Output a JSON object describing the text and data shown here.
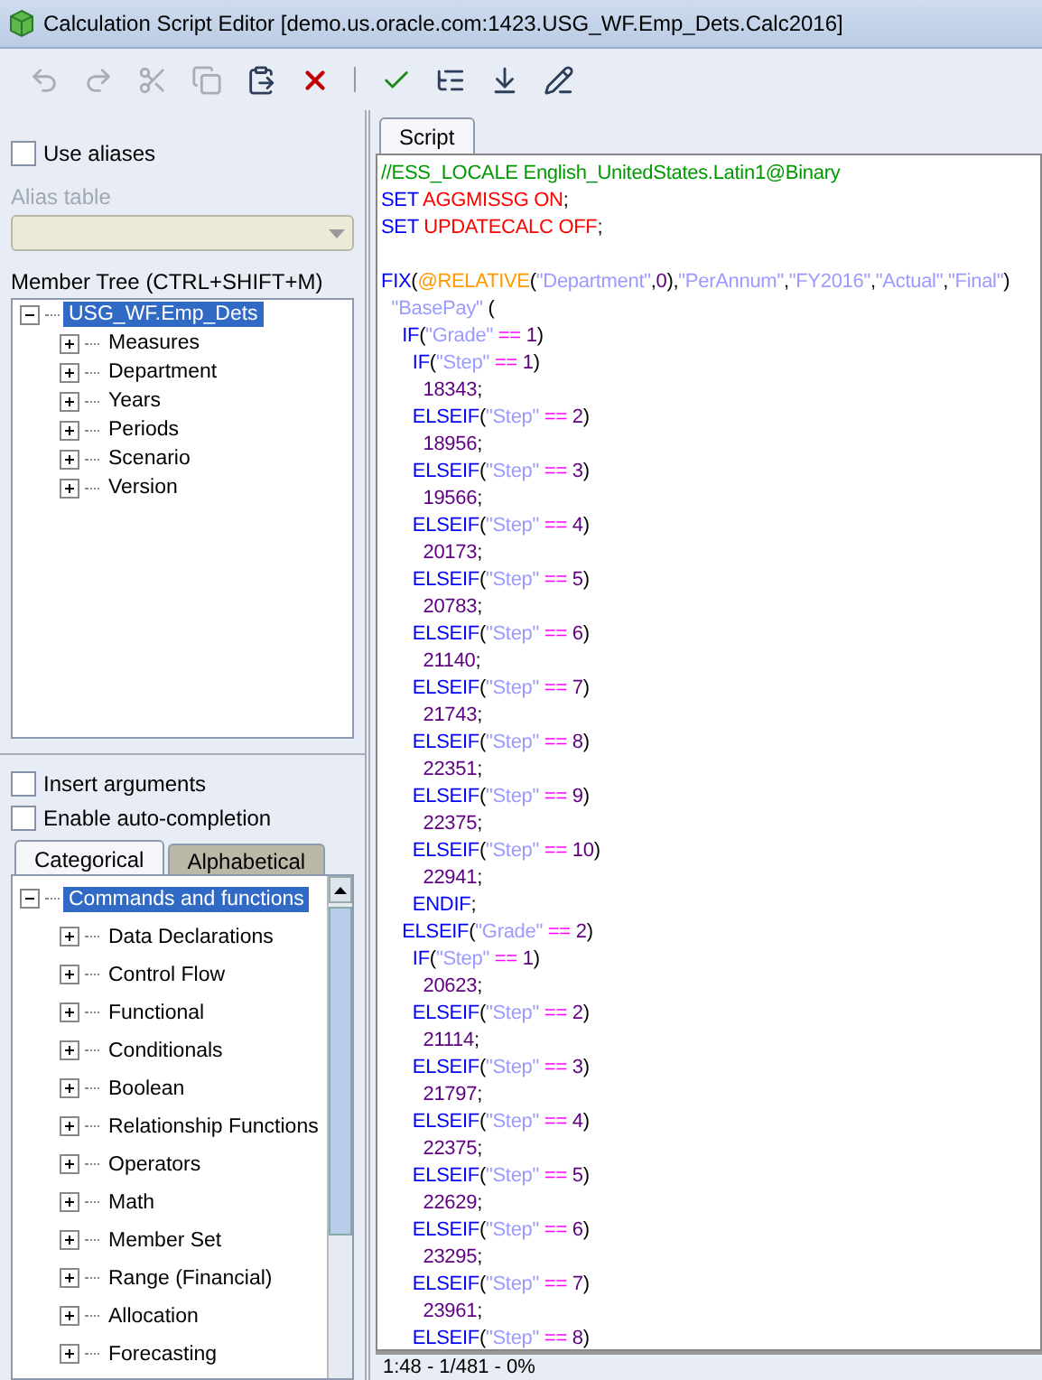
{
  "window": {
    "title": "Calculation Script Editor [demo.us.oracle.com:1423.USG_WF.Emp_Dets.Calc2016]"
  },
  "toolbar": [
    {
      "kind": "undo",
      "disabled": true
    },
    {
      "kind": "redo",
      "disabled": true
    },
    {
      "kind": "cut",
      "disabled": true
    },
    {
      "kind": "copy",
      "disabled": true
    },
    {
      "kind": "paste",
      "disabled": false
    },
    {
      "kind": "delete",
      "disabled": false
    },
    {
      "kind": "separator"
    },
    {
      "kind": "validate",
      "disabled": false
    },
    {
      "kind": "outline",
      "disabled": false
    },
    {
      "kind": "download",
      "disabled": false
    },
    {
      "kind": "insert",
      "disabled": false
    }
  ],
  "left_panel": {
    "use_aliases": {
      "label": "Use aliases",
      "checked": false
    },
    "alias_table": {
      "label": "Alias table",
      "disabled": true
    },
    "member_tree": {
      "label": "Member Tree (CTRL+SHIFT+M)",
      "items": [
        {
          "label": "USG_WF.Emp_Dets",
          "selected": true,
          "expanded": true,
          "children": [
            {
              "label": "Measures",
              "selected": false,
              "expanded": false
            },
            {
              "label": "Department",
              "selected": false,
              "expanded": false
            },
            {
              "label": "Years",
              "selected": false,
              "expanded": false
            },
            {
              "label": "Periods",
              "selected": false,
              "expanded": false
            },
            {
              "label": "Scenario",
              "selected": false,
              "expanded": false
            },
            {
              "label": "Version",
              "selected": false,
              "expanded": false
            }
          ]
        }
      ]
    },
    "options": [
      {
        "label": "Insert arguments",
        "checked": false
      },
      {
        "label": "Enable auto-completion",
        "checked": false
      }
    ],
    "tabs": [
      {
        "label": "Categorical",
        "selected": true
      },
      {
        "label": "Alphabetical",
        "selected": false
      }
    ],
    "function_tree": {
      "items": [
        {
          "label": "Commands and functions",
          "selected": true,
          "expanded": true,
          "children": [
            {
              "label": "Data Declarations",
              "selected": false,
              "expanded": false
            },
            {
              "label": "Control Flow",
              "selected": false,
              "expanded": false
            },
            {
              "label": "Functional",
              "selected": false,
              "expanded": false
            },
            {
              "label": "Conditionals",
              "selected": false,
              "expanded": false
            },
            {
              "label": "Boolean",
              "selected": false,
              "expanded": false
            },
            {
              "label": "Relationship Functions",
              "selected": false,
              "expanded": false
            },
            {
              "label": "Operators",
              "selected": false,
              "expanded": false
            },
            {
              "label": "Math",
              "selected": false,
              "expanded": false
            },
            {
              "label": "Member Set",
              "selected": false,
              "expanded": false
            },
            {
              "label": "Range (Financial)",
              "selected": false,
              "expanded": false
            },
            {
              "label": "Allocation",
              "selected": false,
              "expanded": false
            },
            {
              "label": "Forecasting",
              "selected": false,
              "expanded": false
            }
          ]
        }
      ]
    }
  },
  "editor": {
    "tabs": [
      {
        "label": "Script",
        "selected": true
      }
    ],
    "lines": [
      {
        "kind": "code",
        "tokens": [
          {
            "kind": "comment",
            "text": "//ESS_LOCALE English_UnitedStates.Latin1@Binary"
          }
        ]
      },
      {
        "kind": "code",
        "tokens": [
          {
            "kind": "keyword",
            "text": "SET "
          },
          {
            "kind": "option",
            "text": "AGGMISSG ON"
          },
          {
            "kind": "punct",
            "text": ";"
          }
        ]
      },
      {
        "kind": "code",
        "tokens": [
          {
            "kind": "keyword",
            "text": "SET "
          },
          {
            "kind": "option",
            "text": "UPDATECALC OFF"
          },
          {
            "kind": "punct",
            "text": ";"
          }
        ]
      },
      {
        "kind": "blank"
      },
      {
        "kind": "code",
        "tokens": [
          {
            "kind": "keyword",
            "text": "FIX"
          },
          {
            "kind": "punct",
            "text": "("
          },
          {
            "kind": "function",
            "text": "@RELATIVE"
          },
          {
            "kind": "punct",
            "text": "("
          },
          {
            "kind": "string",
            "text": "\"Department\""
          },
          {
            "kind": "punct",
            "text": ","
          },
          {
            "kind": "number",
            "text": "0"
          },
          {
            "kind": "punct",
            "text": "),"
          },
          {
            "kind": "string",
            "text": "\"PerAnnum\""
          },
          {
            "kind": "punct",
            "text": ","
          },
          {
            "kind": "string",
            "text": "\"FY2016\""
          },
          {
            "kind": "punct",
            "text": ","
          },
          {
            "kind": "string",
            "text": "\"Actual\""
          },
          {
            "kind": "punct",
            "text": ","
          },
          {
            "kind": "string",
            "text": "\"Final\""
          },
          {
            "kind": "punct",
            "text": ")"
          }
        ]
      },
      {
        "kind": "code",
        "tokens": [
          {
            "kind": "string",
            "text": "  \"BasePay\""
          },
          {
            "kind": "punct",
            "text": " ("
          }
        ]
      },
      {
        "kind": "code",
        "tokens": [
          {
            "kind": "keyword",
            "text": "    IF"
          },
          {
            "kind": "punct",
            "text": "("
          },
          {
            "kind": "string",
            "text": "\"Grade\""
          },
          {
            "kind": "op",
            "text": " == "
          },
          {
            "kind": "number",
            "text": "1"
          },
          {
            "kind": "punct",
            "text": ")"
          }
        ]
      },
      {
        "kind": "code",
        "tokens": [
          {
            "kind": "keyword",
            "text": "      IF"
          },
          {
            "kind": "punct",
            "text": "("
          },
          {
            "kind": "string",
            "text": "\"Step\""
          },
          {
            "kind": "op",
            "text": " == "
          },
          {
            "kind": "number",
            "text": "1"
          },
          {
            "kind": "punct",
            "text": ")"
          }
        ]
      },
      {
        "kind": "code",
        "tokens": [
          {
            "kind": "number",
            "text": "        18343"
          },
          {
            "kind": "punct",
            "text": ";"
          }
        ]
      },
      {
        "kind": "code",
        "tokens": [
          {
            "kind": "keyword",
            "text": "      ELSEIF"
          },
          {
            "kind": "punct",
            "text": "("
          },
          {
            "kind": "string",
            "text": "\"Step\""
          },
          {
            "kind": "op",
            "text": " == "
          },
          {
            "kind": "number",
            "text": "2"
          },
          {
            "kind": "punct",
            "text": ")"
          }
        ]
      },
      {
        "kind": "code",
        "tokens": [
          {
            "kind": "number",
            "text": "        18956"
          },
          {
            "kind": "punct",
            "text": ";"
          }
        ]
      },
      {
        "kind": "code",
        "tokens": [
          {
            "kind": "keyword",
            "text": "      ELSEIF"
          },
          {
            "kind": "punct",
            "text": "("
          },
          {
            "kind": "string",
            "text": "\"Step\""
          },
          {
            "kind": "op",
            "text": " == "
          },
          {
            "kind": "number",
            "text": "3"
          },
          {
            "kind": "punct",
            "text": ")"
          }
        ]
      },
      {
        "kind": "code",
        "tokens": [
          {
            "kind": "number",
            "text": "        19566"
          },
          {
            "kind": "punct",
            "text": ";"
          }
        ]
      },
      {
        "kind": "code",
        "tokens": [
          {
            "kind": "keyword",
            "text": "      ELSEIF"
          },
          {
            "kind": "punct",
            "text": "("
          },
          {
            "kind": "string",
            "text": "\"Step\""
          },
          {
            "kind": "op",
            "text": " == "
          },
          {
            "kind": "number",
            "text": "4"
          },
          {
            "kind": "punct",
            "text": ")"
          }
        ]
      },
      {
        "kind": "code",
        "tokens": [
          {
            "kind": "number",
            "text": "        20173"
          },
          {
            "kind": "punct",
            "text": ";"
          }
        ]
      },
      {
        "kind": "code",
        "tokens": [
          {
            "kind": "keyword",
            "text": "      ELSEIF"
          },
          {
            "kind": "punct",
            "text": "("
          },
          {
            "kind": "string",
            "text": "\"Step\""
          },
          {
            "kind": "op",
            "text": " == "
          },
          {
            "kind": "number",
            "text": "5"
          },
          {
            "kind": "punct",
            "text": ")"
          }
        ]
      },
      {
        "kind": "code",
        "tokens": [
          {
            "kind": "number",
            "text": "        20783"
          },
          {
            "kind": "punct",
            "text": ";"
          }
        ]
      },
      {
        "kind": "code",
        "tokens": [
          {
            "kind": "keyword",
            "text": "      ELSEIF"
          },
          {
            "kind": "punct",
            "text": "("
          },
          {
            "kind": "string",
            "text": "\"Step\""
          },
          {
            "kind": "op",
            "text": " == "
          },
          {
            "kind": "number",
            "text": "6"
          },
          {
            "kind": "punct",
            "text": ")"
          }
        ]
      },
      {
        "kind": "code",
        "tokens": [
          {
            "kind": "number",
            "text": "        21140"
          },
          {
            "kind": "punct",
            "text": ";"
          }
        ]
      },
      {
        "kind": "code",
        "tokens": [
          {
            "kind": "keyword",
            "text": "      ELSEIF"
          },
          {
            "kind": "punct",
            "text": "("
          },
          {
            "kind": "string",
            "text": "\"Step\""
          },
          {
            "kind": "op",
            "text": " == "
          },
          {
            "kind": "number",
            "text": "7"
          },
          {
            "kind": "punct",
            "text": ")"
          }
        ]
      },
      {
        "kind": "code",
        "tokens": [
          {
            "kind": "number",
            "text": "        21743"
          },
          {
            "kind": "punct",
            "text": ";"
          }
        ]
      },
      {
        "kind": "code",
        "tokens": [
          {
            "kind": "keyword",
            "text": "      ELSEIF"
          },
          {
            "kind": "punct",
            "text": "("
          },
          {
            "kind": "string",
            "text": "\"Step\""
          },
          {
            "kind": "op",
            "text": " == "
          },
          {
            "kind": "number",
            "text": "8"
          },
          {
            "kind": "punct",
            "text": ")"
          }
        ]
      },
      {
        "kind": "code",
        "tokens": [
          {
            "kind": "number",
            "text": "        22351"
          },
          {
            "kind": "punct",
            "text": ";"
          }
        ]
      },
      {
        "kind": "code",
        "tokens": [
          {
            "kind": "keyword",
            "text": "      ELSEIF"
          },
          {
            "kind": "punct",
            "text": "("
          },
          {
            "kind": "string",
            "text": "\"Step\""
          },
          {
            "kind": "op",
            "text": " == "
          },
          {
            "kind": "number",
            "text": "9"
          },
          {
            "kind": "punct",
            "text": ")"
          }
        ]
      },
      {
        "kind": "code",
        "tokens": [
          {
            "kind": "number",
            "text": "        22375"
          },
          {
            "kind": "punct",
            "text": ";"
          }
        ]
      },
      {
        "kind": "code",
        "tokens": [
          {
            "kind": "keyword",
            "text": "      ELSEIF"
          },
          {
            "kind": "punct",
            "text": "("
          },
          {
            "kind": "string",
            "text": "\"Step\""
          },
          {
            "kind": "op",
            "text": " == "
          },
          {
            "kind": "number",
            "text": "10"
          },
          {
            "kind": "punct",
            "text": ")"
          }
        ]
      },
      {
        "kind": "code",
        "tokens": [
          {
            "kind": "number",
            "text": "        22941"
          },
          {
            "kind": "punct",
            "text": ";"
          }
        ]
      },
      {
        "kind": "code",
        "tokens": [
          {
            "kind": "keyword",
            "text": "      ENDIF"
          },
          {
            "kind": "punct",
            "text": ";"
          }
        ]
      },
      {
        "kind": "code",
        "tokens": [
          {
            "kind": "keyword",
            "text": "    ELSEIF"
          },
          {
            "kind": "punct",
            "text": "("
          },
          {
            "kind": "string",
            "text": "\"Grade\""
          },
          {
            "kind": "op",
            "text": " == "
          },
          {
            "kind": "number",
            "text": "2"
          },
          {
            "kind": "punct",
            "text": ")"
          }
        ]
      },
      {
        "kind": "code",
        "tokens": [
          {
            "kind": "keyword",
            "text": "      IF"
          },
          {
            "kind": "punct",
            "text": "("
          },
          {
            "kind": "string",
            "text": "\"Step\""
          },
          {
            "kind": "op",
            "text": " == "
          },
          {
            "kind": "number",
            "text": "1"
          },
          {
            "kind": "punct",
            "text": ")"
          }
        ]
      },
      {
        "kind": "code",
        "tokens": [
          {
            "kind": "number",
            "text": "        20623"
          },
          {
            "kind": "punct",
            "text": ";"
          }
        ]
      },
      {
        "kind": "code",
        "tokens": [
          {
            "kind": "keyword",
            "text": "      ELSEIF"
          },
          {
            "kind": "punct",
            "text": "("
          },
          {
            "kind": "string",
            "text": "\"Step\""
          },
          {
            "kind": "op",
            "text": " == "
          },
          {
            "kind": "number",
            "text": "2"
          },
          {
            "kind": "punct",
            "text": ")"
          }
        ]
      },
      {
        "kind": "code",
        "tokens": [
          {
            "kind": "number",
            "text": "        21114"
          },
          {
            "kind": "punct",
            "text": ";"
          }
        ]
      },
      {
        "kind": "code",
        "tokens": [
          {
            "kind": "keyword",
            "text": "      ELSEIF"
          },
          {
            "kind": "punct",
            "text": "("
          },
          {
            "kind": "string",
            "text": "\"Step\""
          },
          {
            "kind": "op",
            "text": " == "
          },
          {
            "kind": "number",
            "text": "3"
          },
          {
            "kind": "punct",
            "text": ")"
          }
        ]
      },
      {
        "kind": "code",
        "tokens": [
          {
            "kind": "number",
            "text": "        21797"
          },
          {
            "kind": "punct",
            "text": ";"
          }
        ]
      },
      {
        "kind": "code",
        "tokens": [
          {
            "kind": "keyword",
            "text": "      ELSEIF"
          },
          {
            "kind": "punct",
            "text": "("
          },
          {
            "kind": "string",
            "text": "\"Step\""
          },
          {
            "kind": "op",
            "text": " == "
          },
          {
            "kind": "number",
            "text": "4"
          },
          {
            "kind": "punct",
            "text": ")"
          }
        ]
      },
      {
        "kind": "code",
        "tokens": [
          {
            "kind": "number",
            "text": "        22375"
          },
          {
            "kind": "punct",
            "text": ";"
          }
        ]
      },
      {
        "kind": "code",
        "tokens": [
          {
            "kind": "keyword",
            "text": "      ELSEIF"
          },
          {
            "kind": "punct",
            "text": "("
          },
          {
            "kind": "string",
            "text": "\"Step\""
          },
          {
            "kind": "op",
            "text": " == "
          },
          {
            "kind": "number",
            "text": "5"
          },
          {
            "kind": "punct",
            "text": ")"
          }
        ]
      },
      {
        "kind": "code",
        "tokens": [
          {
            "kind": "number",
            "text": "        22629"
          },
          {
            "kind": "punct",
            "text": ";"
          }
        ]
      },
      {
        "kind": "code",
        "tokens": [
          {
            "kind": "keyword",
            "text": "      ELSEIF"
          },
          {
            "kind": "punct",
            "text": "("
          },
          {
            "kind": "string",
            "text": "\"Step\""
          },
          {
            "kind": "op",
            "text": " == "
          },
          {
            "kind": "number",
            "text": "6"
          },
          {
            "kind": "punct",
            "text": ")"
          }
        ]
      },
      {
        "kind": "code",
        "tokens": [
          {
            "kind": "number",
            "text": "        23295"
          },
          {
            "kind": "punct",
            "text": ";"
          }
        ]
      },
      {
        "kind": "code",
        "tokens": [
          {
            "kind": "keyword",
            "text": "      ELSEIF"
          },
          {
            "kind": "punct",
            "text": "("
          },
          {
            "kind": "string",
            "text": "\"Step\""
          },
          {
            "kind": "op",
            "text": " == "
          },
          {
            "kind": "number",
            "text": "7"
          },
          {
            "kind": "punct",
            "text": ")"
          }
        ]
      },
      {
        "kind": "code",
        "tokens": [
          {
            "kind": "number",
            "text": "        23961"
          },
          {
            "kind": "punct",
            "text": ";"
          }
        ]
      },
      {
        "kind": "code",
        "tokens": [
          {
            "kind": "keyword",
            "text": "      ELSEIF"
          },
          {
            "kind": "punct",
            "text": "("
          },
          {
            "kind": "string",
            "text": "\"Step\""
          },
          {
            "kind": "op",
            "text": " == "
          },
          {
            "kind": "number",
            "text": "8"
          },
          {
            "kind": "punct",
            "text": ")"
          }
        ]
      }
    ],
    "status": "1:48 - 1/481 - 0%"
  }
}
